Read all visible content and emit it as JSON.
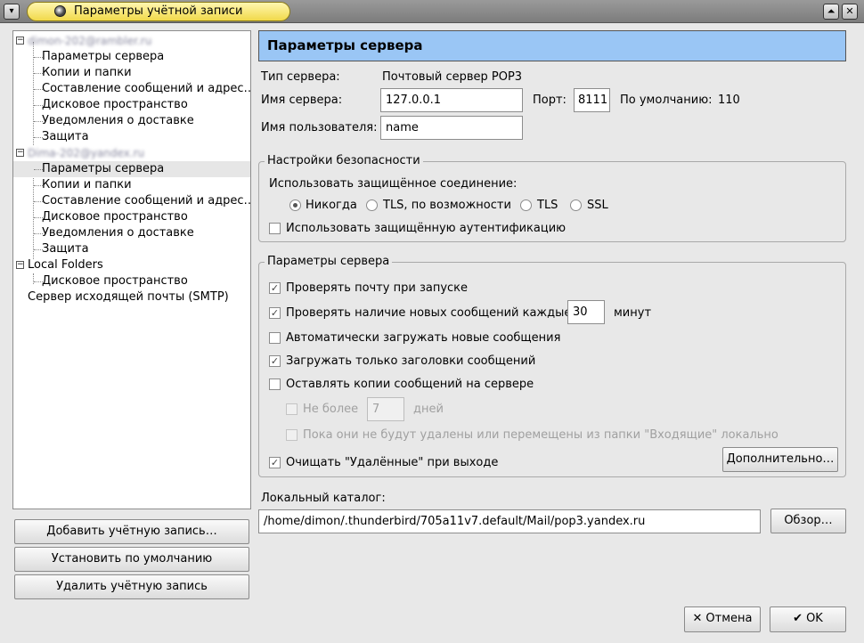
{
  "window": {
    "title": "Параметры учётной записи",
    "menu_glyph": "▾",
    "shade_glyph": "⏶",
    "close_glyph": "✕"
  },
  "tree": {
    "account1": "dimon-202@rambler.ru",
    "account1_items": [
      "Параметры сервера",
      "Копии и папки",
      "Составление сообщений и адрес…",
      "Дисковое пространство",
      "Уведомления о доставке",
      "Защита"
    ],
    "account2": "Dima-202@yandex.ru",
    "account2_items": [
      "Параметры сервера",
      "Копии и папки",
      "Составление сообщений и адрес…",
      "Дисковое пространство",
      "Уведомления о доставке",
      "Защита"
    ],
    "local_folders": "Local Folders",
    "local_items": [
      "Дисковое пространство"
    ],
    "smtp": "Сервер исходящей почты (SMTP)",
    "expander_minus": "−"
  },
  "left_buttons": {
    "add": "Добавить учётную запись…",
    "set_default": "Установить по умолчанию",
    "delete": "Удалить учётную запись"
  },
  "panel": {
    "header": "Параметры сервера",
    "server_type_label": "Тип сервера:",
    "server_type_value": "Почтовый сервер POP3",
    "server_name_label": "Имя сервера:",
    "server_name_value": "127.0.0.1",
    "port_label": "Порт:",
    "port_value": "8111",
    "default_label": "По умолчанию:",
    "default_value": "110",
    "username_label": "Имя пользователя:",
    "username_value": "name"
  },
  "security": {
    "title": "Настройки безопасности",
    "secure_conn_label": "Использовать защищённое соединение:",
    "options": [
      "Никогда",
      "TLS, по возможности",
      "TLS",
      "SSL"
    ],
    "selected": "Никогда",
    "secure_auth": "Использовать защищённую аутентификацию"
  },
  "server_settings": {
    "title": "Параметры сервера",
    "check_on_start": "Проверять почту при запуске",
    "check_every": "Проверять наличие новых сообщений каждые",
    "check_every_value": "30",
    "minutes": "минут",
    "auto_download": "Автоматически загружать новые сообщения",
    "headers_only": "Загружать только заголовки сообщений",
    "leave_on_server": "Оставлять копии сообщений на сервере",
    "no_more_than": "Не более",
    "days_value": "7",
    "days": "дней",
    "until_deleted": "Пока они не будут удалены или перемещены из папки \"Входящие\" локально",
    "empty_trash": "Очищать \"Удалённые\" при выходе",
    "advanced_button": "Дополнительно…",
    "check_mark": "✓"
  },
  "local_dir": {
    "label": "Локальный каталог:",
    "path": "/home/dimon/.thunderbird/705a11v7.default/Mail/pop3.yandex.ru",
    "browse_button": "Обзор…"
  },
  "footer": {
    "cancel": "Отмена",
    "ok": "OK",
    "cancel_glyph": "✕",
    "ok_glyph": "✔"
  }
}
